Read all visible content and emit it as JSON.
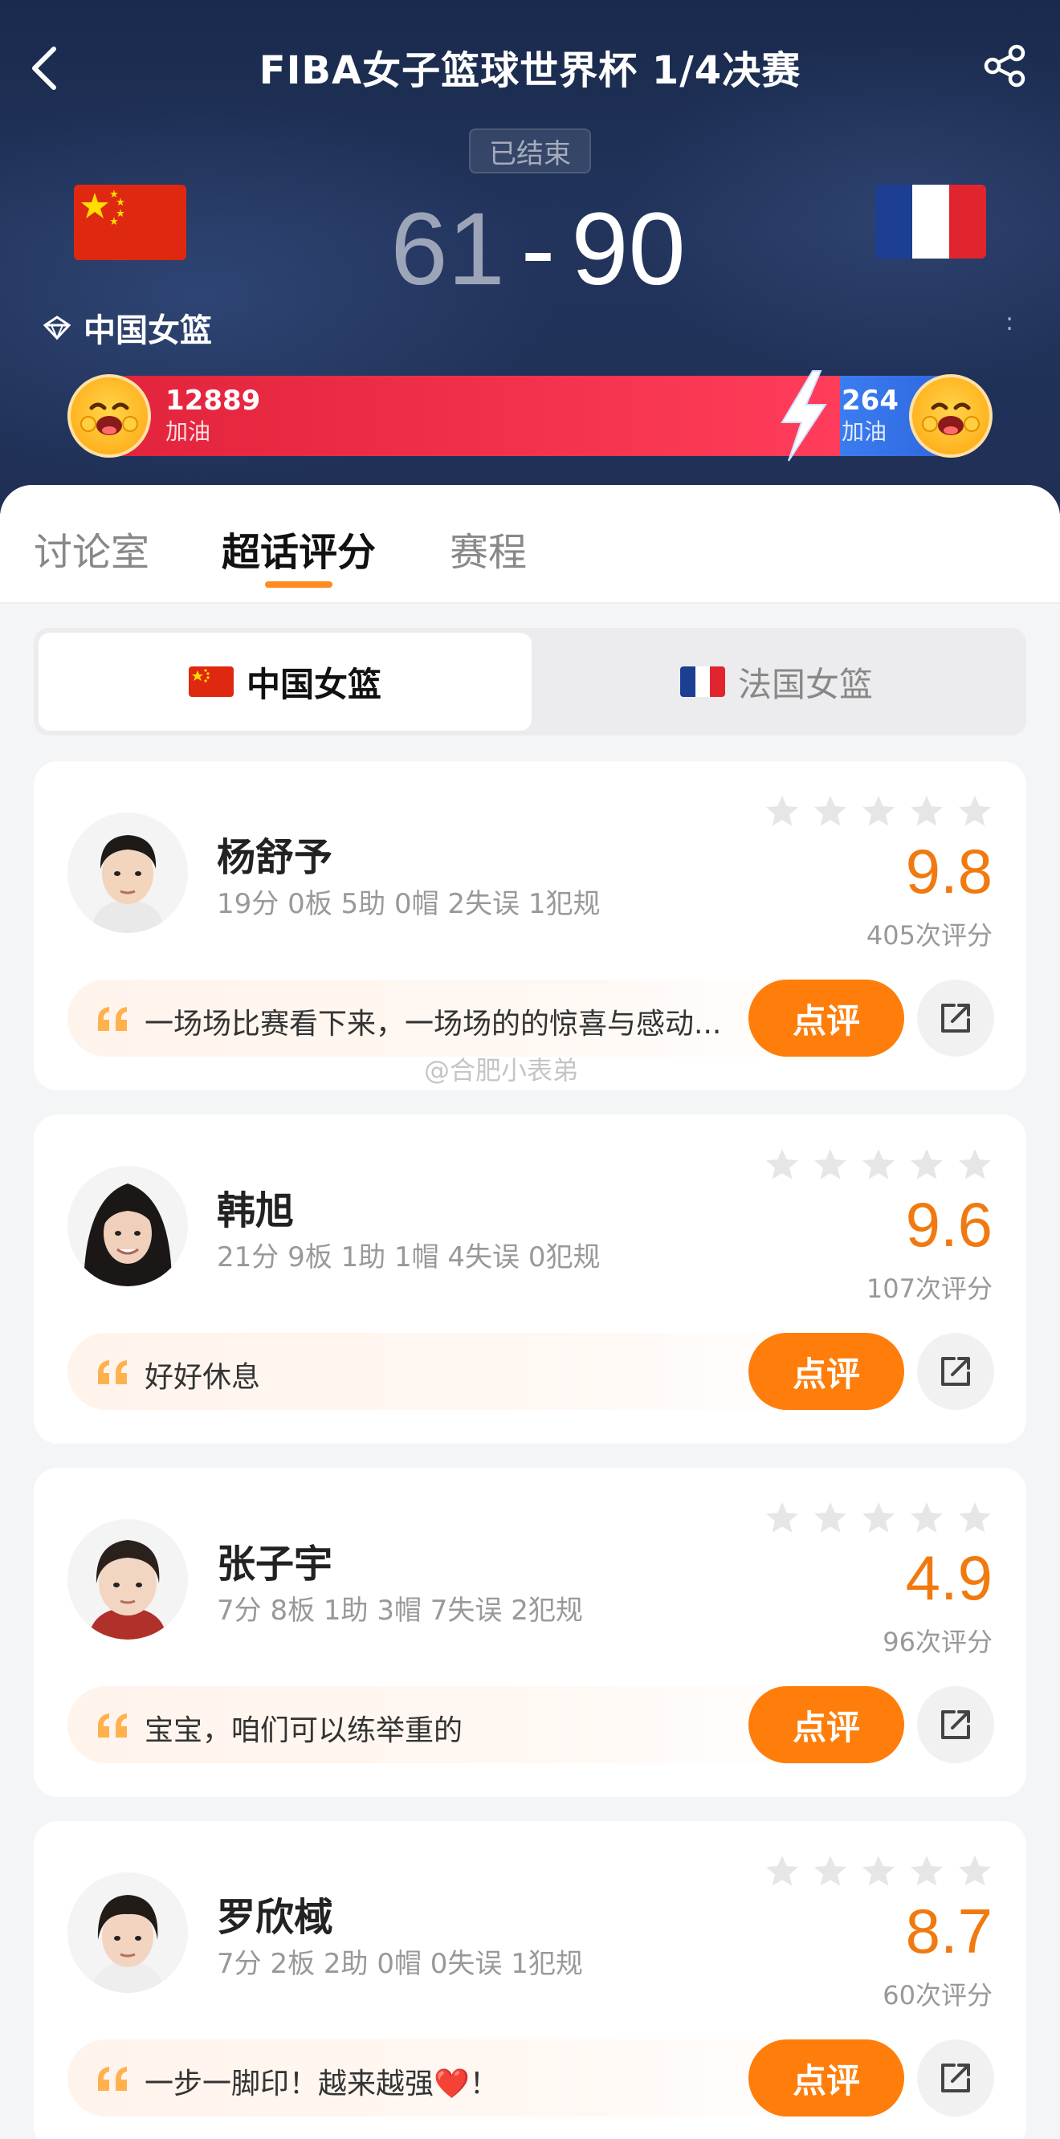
{
  "header": {
    "title": "FIBA女子篮球世界杯 1/4决赛",
    "status": "已结束",
    "home_score": "61",
    "separator": "-",
    "away_score": "90",
    "home_team": "中国女篮",
    "home_cheer": "12889",
    "home_cheer_label": "加油",
    "away_cheer": "264",
    "away_cheer_label": "加油"
  },
  "tabs": [
    "讨论室",
    "超话评分",
    "赛程"
  ],
  "team_switch": {
    "active": "中国女篮",
    "inactive": "法国女篮"
  },
  "players": [
    {
      "name": "杨舒予",
      "stats": "19分 0板 5助 0帽 2失误 1犯规",
      "rating": "9.8",
      "rating_count": "405次评分",
      "comment": "一场场比赛看下来，一场场的的惊喜与感动...",
      "review_label": "点评"
    },
    {
      "name": "韩旭",
      "stats": "21分 9板 1助 1帽 4失误 0犯规",
      "rating": "9.6",
      "rating_count": "107次评分",
      "comment": "好好休息",
      "review_label": "点评"
    },
    {
      "name": "张子宇",
      "stats": "7分 8板 1助 3帽 7失误 2犯规",
      "rating": "4.9",
      "rating_count": "96次评分",
      "comment": "宝宝，咱们可以练举重的",
      "review_label": "点评"
    },
    {
      "name": "罗欣棫",
      "stats": "7分 2板 2助 0帽 0失误 1犯规",
      "rating": "8.7",
      "rating_count": "60次评分",
      "comment": "一步一脚印！越来越强❤️！",
      "review_label": "点评"
    }
  ],
  "watermark": "@合肥小表弟",
  "colors": {
    "accent": "#ff7d0a",
    "rating": "#f07a10",
    "cheer_home": "#e0223a",
    "cheer_away": "#3b7cf0"
  }
}
